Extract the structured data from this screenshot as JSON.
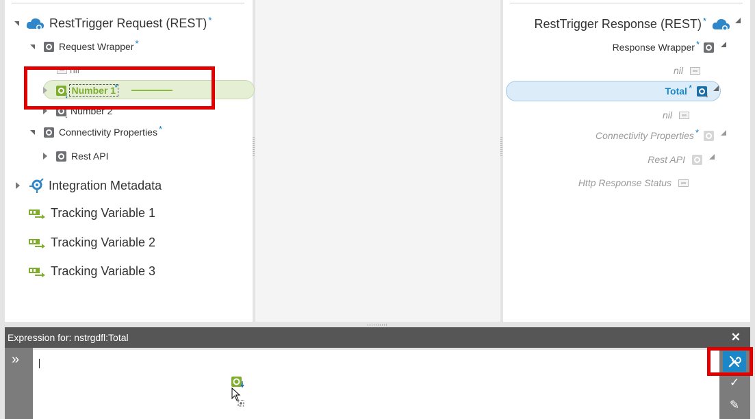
{
  "source_tree": {
    "root": {
      "label": "RestTrigger Request (REST)",
      "required_mark": "*"
    },
    "request_wrapper": {
      "label": "Request Wrapper",
      "required_mark": "*"
    },
    "nil_label": "nil",
    "number1": {
      "label": "Number 1",
      "required_mark": "*"
    },
    "number2": {
      "label": "Number 2"
    },
    "connectivity": {
      "label": "Connectivity Properties",
      "required_mark": "*"
    },
    "rest_api": {
      "label": "Rest API"
    },
    "integration_metadata": {
      "label": "Integration Metadata"
    },
    "tracking_variables": [
      "Tracking Variable 1",
      "Tracking Variable 2",
      "Tracking Variable 3"
    ]
  },
  "target_tree": {
    "root": {
      "label": "RestTrigger Response (REST)",
      "required_mark": "*"
    },
    "response_wrapper": {
      "label": "Response Wrapper",
      "required_mark": "*"
    },
    "nil_top": "nil",
    "total": {
      "label": "Total",
      "required_mark": "*"
    },
    "nil_bottom": "nil",
    "connectivity": {
      "label": "Connectivity Properties",
      "required_mark": "*"
    },
    "rest_api": {
      "label": "Rest API"
    },
    "http_status": {
      "label": "Http Response Status"
    }
  },
  "expression_panel": {
    "title": "Expression for: nstrgdfl:Total",
    "close_glyph": "✕",
    "expand_glyph": "»",
    "check_glyph": "✓",
    "edit_glyph": "✎",
    "value": ""
  },
  "icons": {
    "cloud": "cloud-icon",
    "object": "object-icon",
    "integration": "integration-metadata-icon",
    "tracking": "tracking-variable-icon",
    "tools": "wrench-screwdriver-icon",
    "cursor": "drag-cursor-icon"
  },
  "colors": {
    "accent_blue": "#1a87c9",
    "drag_green": "#7fae2e",
    "highlight_red": "#e00000",
    "expression_header": "#565656"
  }
}
